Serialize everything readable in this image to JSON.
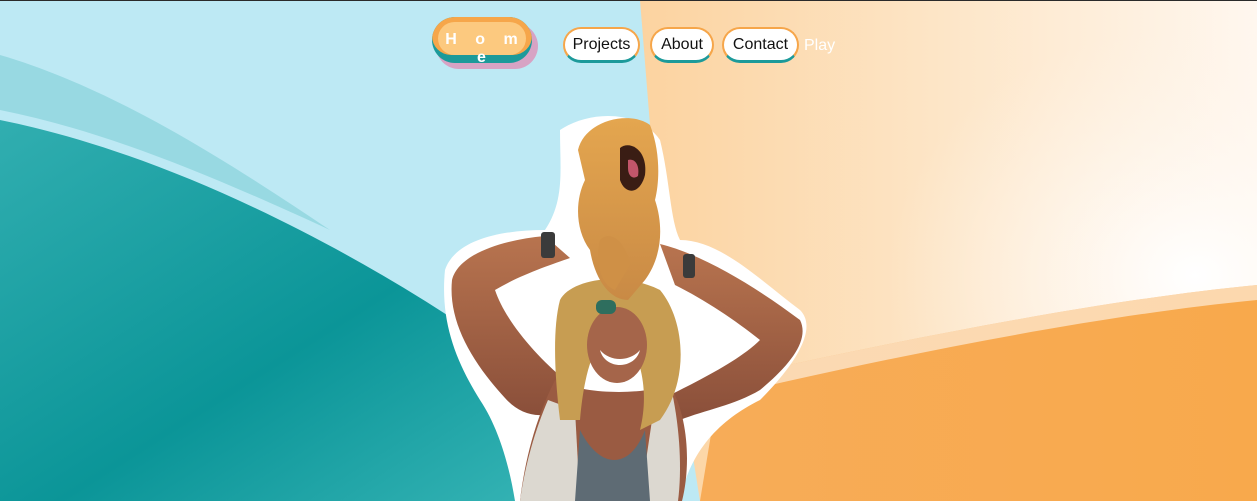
{
  "nav": {
    "home_label": "H o m e",
    "projects_label": "Projects",
    "about_label": "About",
    "contact_label": "Contact",
    "play_label": "Play"
  },
  "hero": {
    "image_icon": "person-with-dog-on-shoulders-icon"
  },
  "colors": {
    "light_blue": "#bfe9f3",
    "teal": "#0f9a9c",
    "orange": "#f6a64a",
    "peach": "#fde2bf",
    "cream": "#fff7ef",
    "pink_shadow": "#d7a3c4"
  }
}
